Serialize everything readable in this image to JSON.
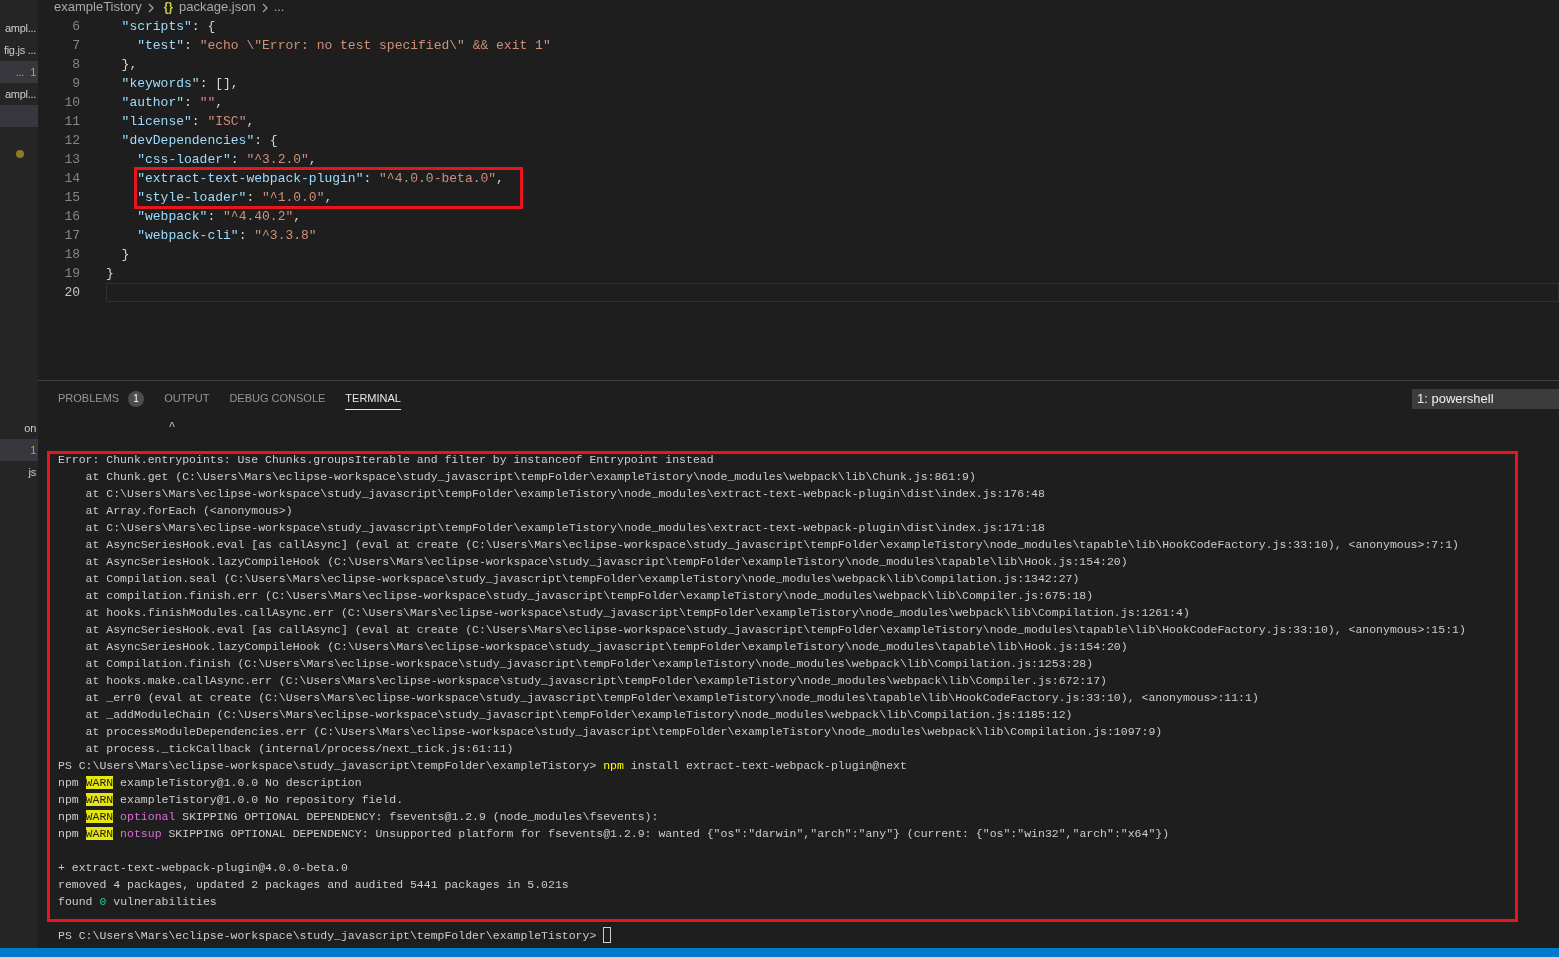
{
  "explorer": {
    "top_items": [
      {
        "label": "ampl...",
        "selected": false
      },
      {
        "label": "fig.js ...",
        "selected": false
      },
      {
        "label": "...",
        "badge": "1",
        "selected": true
      },
      {
        "label": "ampl...",
        "selected": false
      },
      {
        "selected": true
      }
    ],
    "bottom_items": [
      {
        "label": "on",
        "selected": false
      },
      {
        "badge": "1",
        "selected": true
      },
      {
        "label": "js",
        "selected": false
      }
    ]
  },
  "breadcrumb": {
    "folder": "exampleTistory",
    "file_icon": "{}",
    "file": "package.json",
    "more": "..."
  },
  "editor": {
    "lines": [
      {
        "number": "6",
        "current": false,
        "segments": [
          {
            "text": "  \"scripts\"",
            "kind": "key"
          },
          {
            "text": ": {",
            "kind": "punct"
          }
        ]
      },
      {
        "number": "7",
        "current": false,
        "segments": [
          {
            "text": "    \"test\"",
            "kind": "key"
          },
          {
            "text": ": ",
            "kind": "punct"
          },
          {
            "text": "\"echo \\\"Error: no test specified\\\" && exit 1\"",
            "kind": "string"
          }
        ]
      },
      {
        "number": "8",
        "current": false,
        "segments": [
          {
            "text": "  },",
            "kind": "punct"
          }
        ]
      },
      {
        "number": "9",
        "current": false,
        "segments": [
          {
            "text": "  \"keywords\"",
            "kind": "key"
          },
          {
            "text": ": [],",
            "kind": "punct"
          }
        ]
      },
      {
        "number": "10",
        "current": false,
        "segments": [
          {
            "text": "  \"author\"",
            "kind": "key"
          },
          {
            "text": ": ",
            "kind": "punct"
          },
          {
            "text": "\"\"",
            "kind": "string"
          },
          {
            "text": ",",
            "kind": "punct"
          }
        ]
      },
      {
        "number": "11",
        "current": false,
        "segments": [
          {
            "text": "  \"license\"",
            "kind": "key"
          },
          {
            "text": ": ",
            "kind": "punct"
          },
          {
            "text": "\"ISC\"",
            "kind": "string"
          },
          {
            "text": ",",
            "kind": "punct"
          }
        ]
      },
      {
        "number": "12",
        "current": false,
        "segments": [
          {
            "text": "  \"devDependencies\"",
            "kind": "key"
          },
          {
            "text": ": {",
            "kind": "punct"
          }
        ]
      },
      {
        "number": "13",
        "current": false,
        "segments": [
          {
            "text": "    \"css-loader\"",
            "kind": "key"
          },
          {
            "text": ": ",
            "kind": "punct"
          },
          {
            "text": "\"^3.2.0\"",
            "kind": "string"
          },
          {
            "text": ",",
            "kind": "punct"
          }
        ]
      },
      {
        "number": "14",
        "current": false,
        "segments": [
          {
            "text": "    \"extract-text-webpack-plugin\"",
            "kind": "key"
          },
          {
            "text": ": ",
            "kind": "punct"
          },
          {
            "text": "\"^4.0.0-beta.0\"",
            "kind": "string"
          },
          {
            "text": ",",
            "kind": "punct"
          }
        ]
      },
      {
        "number": "15",
        "current": false,
        "segments": [
          {
            "text": "    \"style-loader\"",
            "kind": "key"
          },
          {
            "text": ": ",
            "kind": "punct"
          },
          {
            "text": "\"^1.0.0\"",
            "kind": "string"
          },
          {
            "text": ",",
            "kind": "punct"
          }
        ]
      },
      {
        "number": "16",
        "current": false,
        "segments": [
          {
            "text": "    \"webpack\"",
            "kind": "key"
          },
          {
            "text": ": ",
            "kind": "punct"
          },
          {
            "text": "\"^4.40.2\"",
            "kind": "string"
          },
          {
            "text": ",",
            "kind": "punct"
          }
        ]
      },
      {
        "number": "17",
        "current": false,
        "segments": [
          {
            "text": "    \"webpack-cli\"",
            "kind": "key"
          },
          {
            "text": ": ",
            "kind": "punct"
          },
          {
            "text": "\"^3.3.8\"",
            "kind": "string"
          }
        ]
      },
      {
        "number": "18",
        "current": false,
        "segments": [
          {
            "text": "  }",
            "kind": "punct"
          }
        ]
      },
      {
        "number": "19",
        "current": false,
        "segments": [
          {
            "text": "}",
            "kind": "punct"
          }
        ]
      },
      {
        "number": "20",
        "current": true
      }
    ]
  },
  "panel": {
    "tabs": [
      {
        "label": "PROBLEMS",
        "badge": "1",
        "selected": false
      },
      {
        "label": "OUTPUT",
        "selected": false
      },
      {
        "label": "DEBUG CONSOLE",
        "selected": false
      },
      {
        "label": "TERMINAL",
        "selected": true
      }
    ],
    "terminal_select": "1: powershell",
    "terminal": {
      "blocks": [
        [
          [
            {
              "text": "                ^",
              "kind": "plain"
            }
          ]
        ],
        [
          [
            {
              "text": "Error: Chunk.entrypoints: Use Chunks.groupsIterable and filter by instanceof Entrypoint instead",
              "kind": "plain"
            }
          ],
          [
            {
              "text": "    at Chunk.get (C:\\Users\\Mars\\eclipse-workspace\\study_javascript\\tempFolder\\exampleTistory\\node_modules\\webpack\\lib\\Chunk.js:861:9)",
              "kind": "plain"
            }
          ],
          [
            {
              "text": "    at C:\\Users\\Mars\\eclipse-workspace\\study_javascript\\tempFolder\\exampleTistory\\node_modules\\extract-text-webpack-plugin\\dist\\index.js:176:48",
              "kind": "plain"
            }
          ],
          [
            {
              "text": "    at Array.forEach (<anonymous>)",
              "kind": "plain"
            }
          ],
          [
            {
              "text": "    at C:\\Users\\Mars\\eclipse-workspace\\study_javascript\\tempFolder\\exampleTistory\\node_modules\\extract-text-webpack-plugin\\dist\\index.js:171:18",
              "kind": "plain"
            }
          ],
          [
            {
              "text": "    at AsyncSeriesHook.eval [as callAsync] (eval at create (C:\\Users\\Mars\\eclipse-workspace\\study_javascript\\tempFolder\\exampleTistory\\node_modules\\tapable\\lib\\HookCodeFactory.js:33:10), <anonymous>:7:1)",
              "kind": "plain"
            }
          ],
          [
            {
              "text": "    at AsyncSeriesHook.lazyCompileHook (C:\\Users\\Mars\\eclipse-workspace\\study_javascript\\tempFolder\\exampleTistory\\node_modules\\tapable\\lib\\Hook.js:154:20)",
              "kind": "plain"
            }
          ],
          [
            {
              "text": "    at Compilation.seal (C:\\Users\\Mars\\eclipse-workspace\\study_javascript\\tempFolder\\exampleTistory\\node_modules\\webpack\\lib\\Compilation.js:1342:27)",
              "kind": "plain"
            }
          ],
          [
            {
              "text": "    at compilation.finish.err (C:\\Users\\Mars\\eclipse-workspace\\study_javascript\\tempFolder\\exampleTistory\\node_modules\\webpack\\lib\\Compiler.js:675:18)",
              "kind": "plain"
            }
          ],
          [
            {
              "text": "    at hooks.finishModules.callAsync.err (C:\\Users\\Mars\\eclipse-workspace\\study_javascript\\tempFolder\\exampleTistory\\node_modules\\webpack\\lib\\Compilation.js:1261:4)",
              "kind": "plain"
            }
          ],
          [
            {
              "text": "    at AsyncSeriesHook.eval [as callAsync] (eval at create (C:\\Users\\Mars\\eclipse-workspace\\study_javascript\\tempFolder\\exampleTistory\\node_modules\\tapable\\lib\\HookCodeFactory.js:33:10), <anonymous>:15:1)",
              "kind": "plain"
            }
          ],
          [
            {
              "text": "    at AsyncSeriesHook.lazyCompileHook (C:\\Users\\Mars\\eclipse-workspace\\study_javascript\\tempFolder\\exampleTistory\\node_modules\\tapable\\lib\\Hook.js:154:20)",
              "kind": "plain"
            }
          ],
          [
            {
              "text": "    at Compilation.finish (C:\\Users\\Mars\\eclipse-workspace\\study_javascript\\tempFolder\\exampleTistory\\node_modules\\webpack\\lib\\Compilation.js:1253:28)",
              "kind": "plain"
            }
          ],
          [
            {
              "text": "    at hooks.make.callAsync.err (C:\\Users\\Mars\\eclipse-workspace\\study_javascript\\tempFolder\\exampleTistory\\node_modules\\webpack\\lib\\Compiler.js:672:17)",
              "kind": "plain"
            }
          ],
          [
            {
              "text": "    at _err0 (eval at create (C:\\Users\\Mars\\eclipse-workspace\\study_javascript\\tempFolder\\exampleTistory\\node_modules\\tapable\\lib\\HookCodeFactory.js:33:10), <anonymous>:11:1)",
              "kind": "plain"
            }
          ],
          [
            {
              "text": "    at _addModuleChain (C:\\Users\\Mars\\eclipse-workspace\\study_javascript\\tempFolder\\exampleTistory\\node_modules\\webpack\\lib\\Compilation.js:1185:12)",
              "kind": "plain"
            }
          ],
          [
            {
              "text": "    at processModuleDependencies.err (C:\\Users\\Mars\\eclipse-workspace\\study_javascript\\tempFolder\\exampleTistory\\node_modules\\webpack\\lib\\Compilation.js:1097:9)",
              "kind": "plain"
            }
          ],
          [
            {
              "text": "    at process._tickCallback (internal/process/next_tick.js:61:11)",
              "kind": "plain"
            }
          ],
          [
            {
              "text": "PS C:\\Users\\Mars\\eclipse-workspace\\study_javascript\\tempFolder\\exampleTistory> ",
              "kind": "plain"
            },
            {
              "text": "npm",
              "kind": "command"
            },
            {
              "text": " install extract-text-webpack-plugin@next",
              "kind": "plain"
            }
          ],
          [
            {
              "text": "npm ",
              "kind": "plain"
            },
            {
              "text": "WARN",
              "kind": "warn"
            },
            {
              "text": " exampleTistory@1.0.0 No description",
              "kind": "plain"
            }
          ],
          [
            {
              "text": "npm ",
              "kind": "plain"
            },
            {
              "text": "WARN",
              "kind": "warn"
            },
            {
              "text": " exampleTistory@1.0.0 No repository field.",
              "kind": "plain"
            }
          ],
          [
            {
              "text": "npm ",
              "kind": "plain"
            },
            {
              "text": "WARN",
              "kind": "warn"
            },
            {
              "text": " optional",
              "kind": "tag"
            },
            {
              "text": " SKIPPING OPTIONAL DEPENDENCY: fsevents@1.2.9 (node_modules\\fsevents):",
              "kind": "plain"
            }
          ],
          [
            {
              "text": "npm ",
              "kind": "plain"
            },
            {
              "text": "WARN",
              "kind": "warn"
            },
            {
              "text": " notsup",
              "kind": "tag"
            },
            {
              "text": " SKIPPING OPTIONAL DEPENDENCY: Unsupported platform for fsevents@1.2.9: wanted {\"os\":\"darwin\",\"arch\":\"any\"} (current: {\"os\":\"win32\",\"arch\":\"x64\"})",
              "kind": "plain"
            }
          ]
        ],
        [
          [
            {
              "text": "+ extract-text-webpack-plugin@4.0.0-beta.0",
              "kind": "plain"
            }
          ],
          [
            {
              "text": "removed 4 packages, updated 2 packages and audited 5441 packages in 5.021s",
              "kind": "plain"
            }
          ],
          [
            {
              "text": "found ",
              "kind": "plain"
            },
            {
              "text": "0",
              "kind": "number"
            },
            {
              "text": " vulnerabilities",
              "kind": "plain"
            }
          ]
        ],
        [
          [
            {
              "text": "PS C:\\Users\\Mars\\eclipse-workspace\\study_javascript\\tempFolder\\exampleTistory> ",
              "kind": "plain"
            },
            {
              "kind": "cursor"
            }
          ]
        ]
      ]
    }
  }
}
